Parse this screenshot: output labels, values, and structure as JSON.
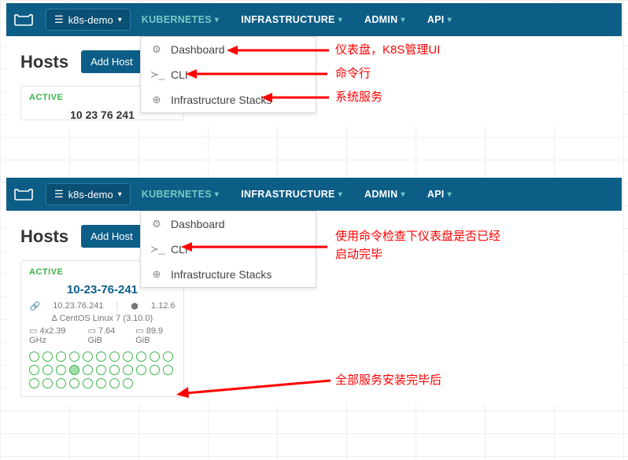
{
  "top": {
    "env": "k8s-demo",
    "nav": {
      "kubernetes": "KUBERNETES",
      "infrastructure": "INFRASTRUCTURE",
      "admin": "ADMIN",
      "api": "API"
    },
    "menu": {
      "dashboard": "Dashboard",
      "cli": "CLI",
      "stacks": "Infrastructure Stacks"
    },
    "hosts_title": "Hosts",
    "add_host": "Add Host",
    "status": "ACTIVE",
    "host_name_cut": "10 23 76 241",
    "ann_dashboard": "仪表盘，K8S管理UI",
    "ann_cli": "命令行",
    "ann_stacks": "系统服务"
  },
  "bottom": {
    "env": "k8s-demo",
    "nav": {
      "kubernetes": "KUBERNETES",
      "infrastructure": "INFRASTRUCTURE",
      "admin": "ADMIN",
      "api": "API"
    },
    "menu": {
      "dashboard": "Dashboard",
      "cli": "CLI",
      "stacks": "Infrastructure Stacks"
    },
    "hosts_title": "Hosts",
    "add_host": "Add Host",
    "status": "ACTIVE",
    "host_name": "10-23-76-241",
    "ip": "10.23.76.241",
    "docker": "1.12.6",
    "os": "CentOS Linux 7 (3.10.0)",
    "cpu": "4x2.39 GHz",
    "mem": "7.64 GiB",
    "disk": "89.9 GiB",
    "ann_cli_check": "使用命令检查下仪表盘是否已经启动完毕",
    "ann_services_done": "全部服务安装完毕后"
  }
}
